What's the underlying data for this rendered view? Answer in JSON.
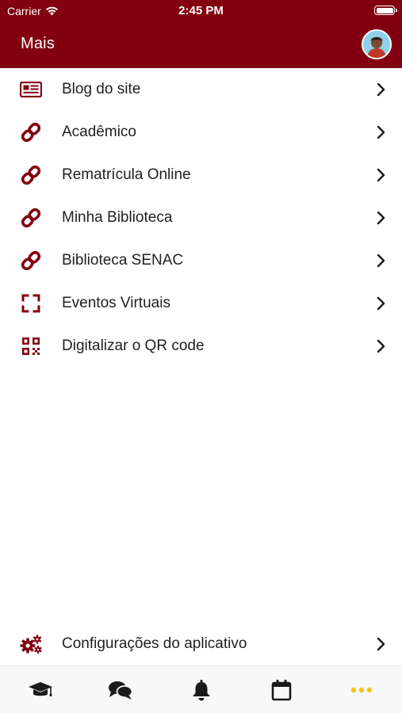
{
  "status_bar": {
    "carrier": "Carrier",
    "time": "2:45 PM"
  },
  "header": {
    "title": "Mais"
  },
  "menu": {
    "items": [
      {
        "label": "Blog do site",
        "icon": "newspaper-icon"
      },
      {
        "label": "Acadêmico",
        "icon": "link-icon"
      },
      {
        "label": "Rematrícula Online",
        "icon": "link-icon"
      },
      {
        "label": "Minha Biblioteca",
        "icon": "link-icon"
      },
      {
        "label": "Biblioteca SENAC",
        "icon": "link-icon"
      },
      {
        "label": "Eventos Virtuais",
        "icon": "expand-icon"
      },
      {
        "label": "Digitalizar o QR code",
        "icon": "qr-code-icon"
      }
    ]
  },
  "settings": {
    "label": "Configurações do aplicativo",
    "icon": "gears-icon"
  },
  "tabbar": {
    "tabs": [
      {
        "icon": "graduation-cap-icon"
      },
      {
        "icon": "chat-bubbles-icon"
      },
      {
        "icon": "bell-icon"
      },
      {
        "icon": "calendar-icon"
      },
      {
        "icon": "more-dots-icon",
        "active": true
      }
    ]
  },
  "colors": {
    "brand": "#820010",
    "text": "#1f1f1f",
    "tab_icon": "#1a1a1a",
    "tab_active": "#f5c518"
  }
}
